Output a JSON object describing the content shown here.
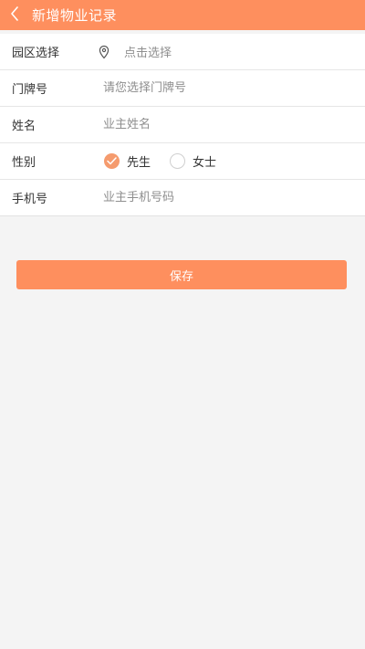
{
  "header": {
    "title": "新增物业记录",
    "back_icon": "chevron-left-icon",
    "background_color": "#fe8f5e"
  },
  "form": {
    "park": {
      "label": "园区选择",
      "icon": "location-pin-icon",
      "value": "点击选择"
    },
    "door_number": {
      "label": "门牌号",
      "placeholder": "请您选择门牌号"
    },
    "name": {
      "label": "姓名",
      "placeholder": "业主姓名"
    },
    "gender": {
      "label": "性别",
      "options": [
        {
          "label": "先生",
          "selected": true
        },
        {
          "label": "女士",
          "selected": false
        }
      ],
      "accent_color": "#f59b6e"
    },
    "phone": {
      "label": "手机号",
      "placeholder": "业主手机号码"
    }
  },
  "save_button": {
    "label": "保存"
  }
}
